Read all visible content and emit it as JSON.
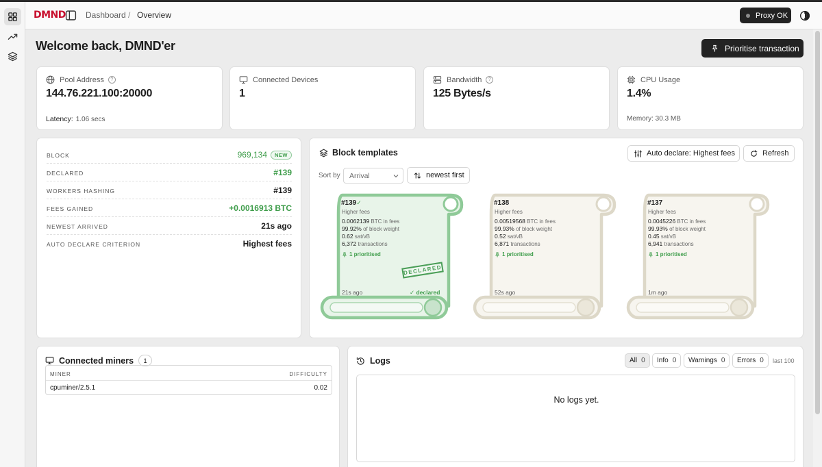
{
  "app": {
    "logo": "DMND"
  },
  "breadcrumb": {
    "parent": "Dashboard",
    "separator": "/",
    "current": "Overview"
  },
  "status": {
    "proxy_label": "Proxy OK"
  },
  "welcome": "Welcome back, DMND'er",
  "prioritise_label": "Prioritise transaction",
  "stats": {
    "pool": {
      "label": "Pool Address",
      "help": "?",
      "value": "144.76.221.100:20000",
      "latency_label": "Latency:",
      "latency_value": "1.06 secs"
    },
    "devices": {
      "label": "Connected Devices",
      "value": "1"
    },
    "bandwidth": {
      "label": "Bandwidth",
      "help": "?",
      "value": "125 Bytes/s"
    },
    "cpu": {
      "label": "CPU Usage",
      "value": "1.4%",
      "memory": "Memory: 30.3 MB"
    }
  },
  "block_info": {
    "block_label": "BLOCK",
    "block_value": "969,134",
    "new_badge": "NEW",
    "declared_label": "DECLARED",
    "declared_value": "#139",
    "workers_label": "WORKERS HASHING",
    "workers_value": "#139",
    "fees_label": "FEES GAINED",
    "fees_value": "+0.0016913 BTC",
    "newest_label": "NEWEST ARRIVED",
    "newest_value": "21s ago",
    "criterion_label": "AUTO DECLARE CRITERION",
    "criterion_value": "Highest fees"
  },
  "templates": {
    "title": "Block templates",
    "auto_declare_label": "Auto declare: Highest fees",
    "refresh_label": "Refresh",
    "sort_label": "Sort by",
    "sort_value": "Arrival",
    "order_label": "newest first",
    "cards": [
      {
        "id": "#139",
        "check": "✓",
        "tag": "Higher fees",
        "fees": "0.0062139",
        "fees_unit": "BTC in fees",
        "weight": "99.92%",
        "weight_unit": "of block weight",
        "rate": "0.62",
        "rate_unit": "sat/vB",
        "txs": "6,372",
        "txs_unit": "transactions",
        "prioritised": "1 prioritised",
        "ago": "21s ago",
        "declared": "✓ declared",
        "stamp": "DECLARED"
      },
      {
        "id": "#138",
        "tag": "Higher fees",
        "fees": "0.00519568",
        "fees_unit": "BTC in fees",
        "weight": "99.93%",
        "weight_unit": "of block weight",
        "rate": "0.52",
        "rate_unit": "sat/vB",
        "txs": "6,871",
        "txs_unit": "transactions",
        "prioritised": "1 prioritised",
        "ago": "52s ago"
      },
      {
        "id": "#137",
        "tag": "Higher fees",
        "fees": "0.0045226",
        "fees_unit": "BTC in fees",
        "weight": "99.93%",
        "weight_unit": "of block weight",
        "rate": "0.45",
        "rate_unit": "sat/vB",
        "txs": "6,941",
        "txs_unit": "transactions",
        "prioritised": "1 prioritised",
        "ago": "1m ago"
      }
    ]
  },
  "miners": {
    "title": "Connected miners",
    "count": "1",
    "columns": [
      "MINER",
      "DIFFICULTY"
    ],
    "rows": [
      {
        "miner": "cpuminer/2.5.1",
        "difficulty": "0.02"
      }
    ]
  },
  "logs": {
    "title": "Logs",
    "filters": [
      {
        "label": "All",
        "count": "0"
      },
      {
        "label": "Info",
        "count": "0"
      },
      {
        "label": "Warnings",
        "count": "0"
      },
      {
        "label": "Errors",
        "count": "0"
      }
    ],
    "last_label": "last 100",
    "empty": "No logs yet."
  },
  "colors": {
    "accent_green": "#3f9d4b",
    "brand_red": "#c8102e",
    "dark": "#232323"
  }
}
